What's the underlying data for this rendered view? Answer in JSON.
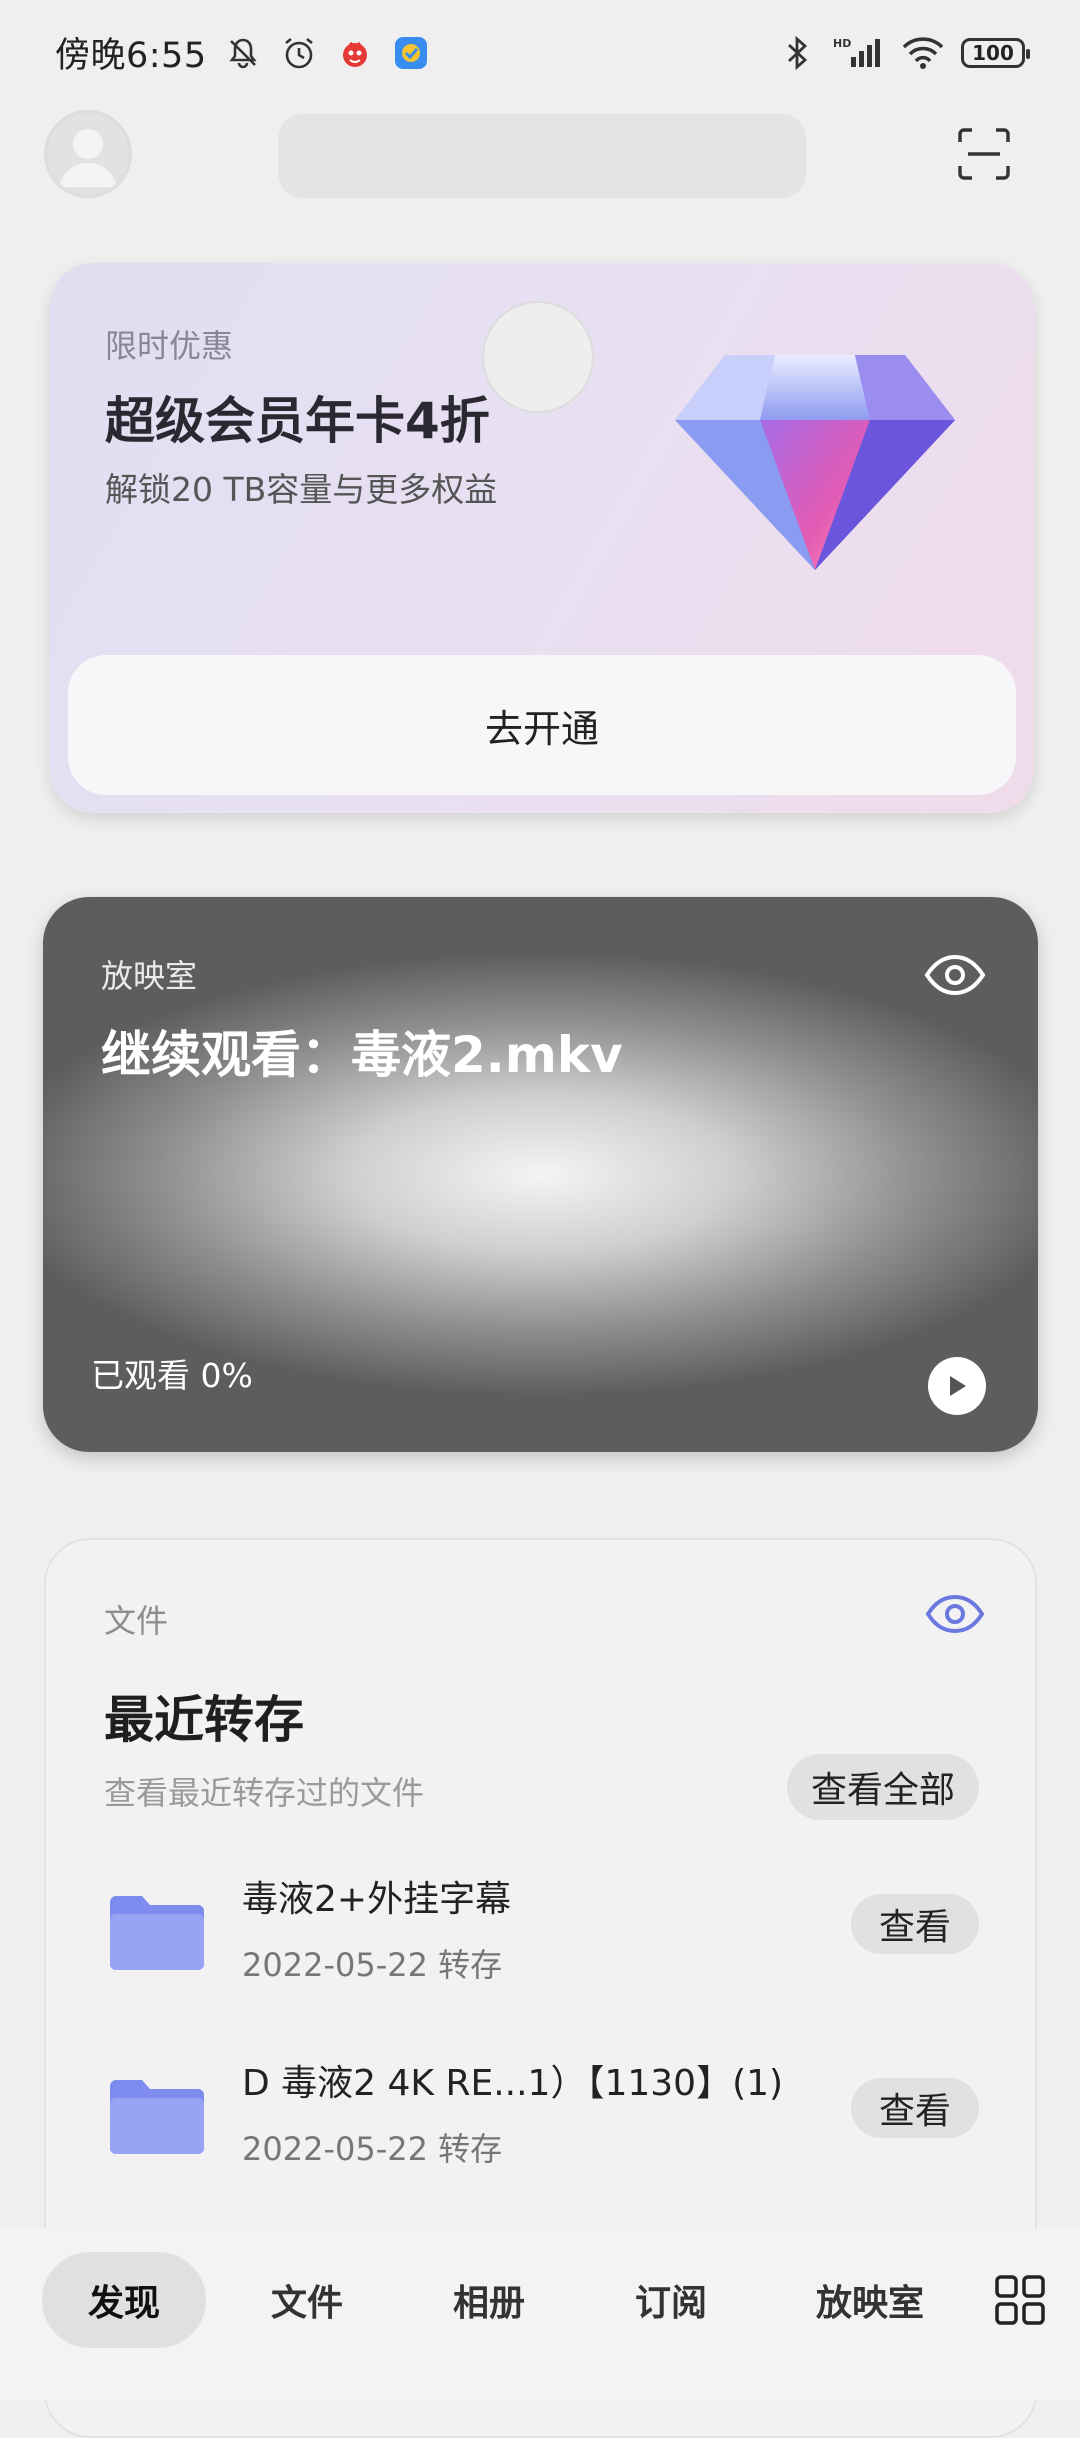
{
  "status_bar": {
    "time": "傍晚6:55",
    "battery": "100",
    "network_badge": "HD",
    "icons": [
      "bell-off-icon",
      "alarm-icon",
      "app-notification-icon",
      "app-notification-icon-2",
      "bluetooth-icon",
      "signal-icon",
      "wifi-icon",
      "battery-icon"
    ]
  },
  "header": {
    "icons": [
      "avatar-icon",
      "scan-icon"
    ]
  },
  "promo": {
    "tag": "限时优惠",
    "title": "超级会员年卡4折",
    "subtitle": "解锁20 TB容量与更多权益",
    "button_label": "去开通",
    "icon": "diamond-icon"
  },
  "theater": {
    "tag": "放映室",
    "title": "继续观看：毒液2.mkv",
    "progress_text": "已观看 0%",
    "progress_value": 0,
    "icons": [
      "eye-icon",
      "play-icon"
    ]
  },
  "files": {
    "tag": "文件",
    "title": "最近转存",
    "subtitle": "查看最近转存过的文件",
    "view_all_label": "查看全部",
    "items": [
      {
        "name": "毒液2+外挂字幕",
        "date": "2022-05-22 转存",
        "action": "查看"
      },
      {
        "name": "D 毒液2 4K RE...1）【1130】(1)",
        "date": "2022-05-22 转存",
        "action": "查看"
      }
    ],
    "accent_color": "#6b78e0"
  },
  "nav": {
    "items": [
      {
        "label": "发现",
        "active": true
      },
      {
        "label": "文件",
        "active": false
      },
      {
        "label": "相册",
        "active": false
      },
      {
        "label": "订阅",
        "active": false
      },
      {
        "label": "放映室",
        "active": false
      }
    ],
    "grid_icon": "grid-icon"
  }
}
